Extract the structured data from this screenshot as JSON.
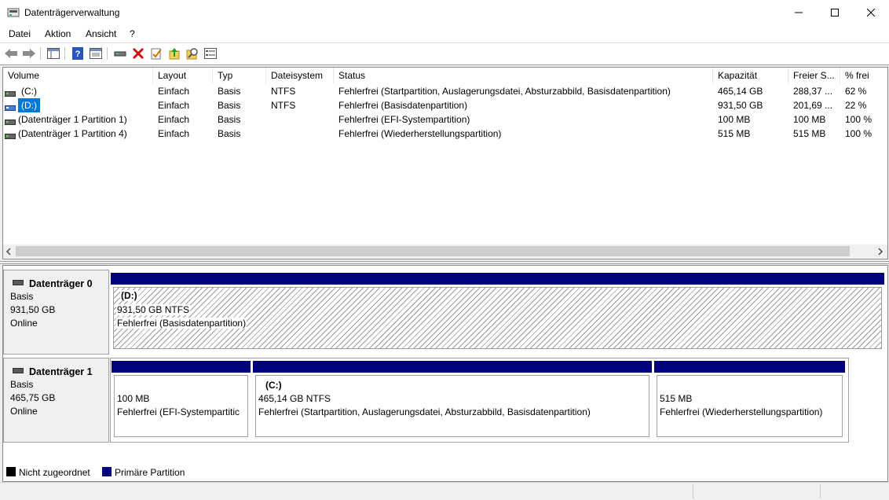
{
  "window": {
    "title": "Datenträgerverwaltung"
  },
  "menu": [
    "Datei",
    "Aktion",
    "Ansicht",
    "?"
  ],
  "toolbar": {
    "icons": [
      "back-icon",
      "forward-icon",
      "show-hide-console-tree-icon",
      "help-icon",
      "properties-icon",
      "connect-disk-icon",
      "delete-icon",
      "checklist-icon",
      "export-up-icon",
      "search-icon",
      "list-view-icon"
    ]
  },
  "columns": [
    "Volume",
    "Layout",
    "Typ",
    "Dateisystem",
    "Status",
    "Kapazität",
    "Freier S...",
    "% frei"
  ],
  "rows": [
    {
      "volume": "(C:)",
      "layout": "Einfach",
      "typ": "Basis",
      "fs": "NTFS",
      "status": "Fehlerfrei (Startpartition, Auslagerungsdatei, Absturzabbild, Basisdatenpartition)",
      "capacity": "465,14 GB",
      "free": "288,37 ...",
      "pct": "62 %"
    },
    {
      "volume": "(D:)",
      "layout": "Einfach",
      "typ": "Basis",
      "fs": "NTFS",
      "status": "Fehlerfrei (Basisdatenpartition)",
      "capacity": "931,50 GB",
      "free": "201,69 ...",
      "pct": "22 %"
    },
    {
      "volume": "(Datenträger 1 Partition 1)",
      "layout": "Einfach",
      "typ": "Basis",
      "fs": "",
      "status": "Fehlerfrei (EFI-Systempartition)",
      "capacity": "100 MB",
      "free": "100 MB",
      "pct": "100 %"
    },
    {
      "volume": "(Datenträger 1 Partition 4)",
      "layout": "Einfach",
      "typ": "Basis",
      "fs": "",
      "status": "Fehlerfrei (Wiederherstellungspartition)",
      "capacity": "515 MB",
      "free": "515 MB",
      "pct": "100 %"
    }
  ],
  "disks": [
    {
      "name": "Datenträger 0",
      "type": "Basis",
      "size": "931,50 GB",
      "state": "Online",
      "partitions": [
        {
          "label": "(D:)",
          "line1": "931,50 GB NTFS",
          "line2": "Fehlerfrei (Basisdatenpartition)"
        }
      ]
    },
    {
      "name": "Datenträger 1",
      "type": "Basis",
      "size": "465,75 GB",
      "state": "Online",
      "partitions": [
        {
          "label": "",
          "line1": "100 MB",
          "line2": "Fehlerfrei (EFI-Systempartitic"
        },
        {
          "label": "(C:)",
          "line1": "465,14 GB NTFS",
          "line2": "Fehlerfrei (Startpartition, Auslagerungsdatei, Absturzabbild, Basisdatenpartition)"
        },
        {
          "label": "",
          "line1": "515 MB",
          "line2": "Fehlerfrei (Wiederherstellungspartition)"
        }
      ]
    }
  ],
  "legend": [
    {
      "label": "Nicht zugeordnet",
      "color": "#000000"
    },
    {
      "label": "Primäre Partition",
      "color": "#00007b"
    }
  ],
  "colors": {
    "selection": "#0078d7",
    "primary_partition": "#00007b"
  }
}
